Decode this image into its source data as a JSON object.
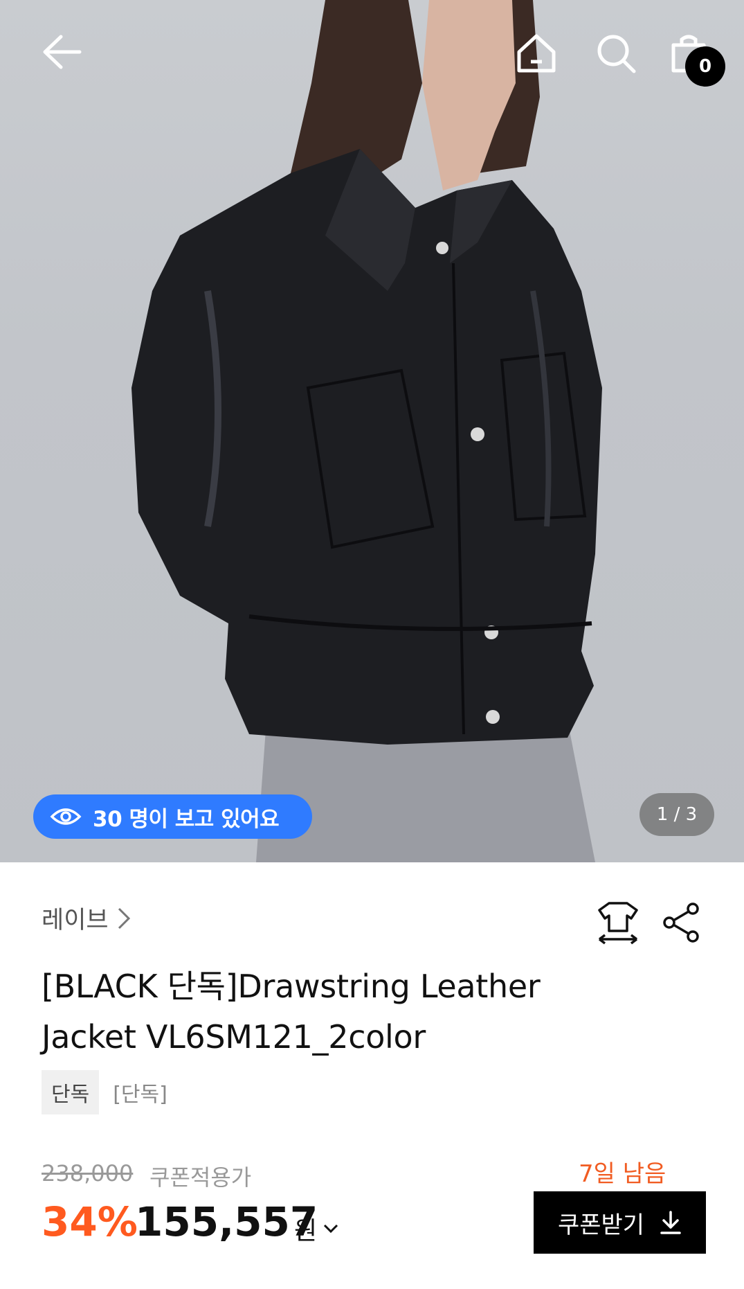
{
  "header": {
    "back_icon": "arrow-left-icon",
    "home_icon": "home-icon",
    "search_icon": "search-icon",
    "bag_icon": "shopping-bag-icon",
    "cart_count": "0"
  },
  "gallery": {
    "viewers_text": "30 명이 보고 있어요",
    "viewers_icon": "eye-icon",
    "pager_text": "1 / 3",
    "accent_color": "#2f7bff"
  },
  "product": {
    "brand": "레이브",
    "title_line1": "[BLACK 단독]Drawstring Leather",
    "title_line2": "Jacket VL6SM121_2color",
    "tag_box": "단독",
    "tag_plain": "[단독]",
    "fit_icon": "size-fit-icon",
    "share_icon": "share-icon"
  },
  "price": {
    "original": "238,000",
    "coupon_label": "쿠폰적용가",
    "discount": "34%",
    "final": "155,557",
    "currency": "원",
    "discount_color": "#ff5a1f"
  },
  "coupon": {
    "days_left": "7일 남음",
    "button_label": "쿠폰받기",
    "button_icon": "download-icon"
  }
}
